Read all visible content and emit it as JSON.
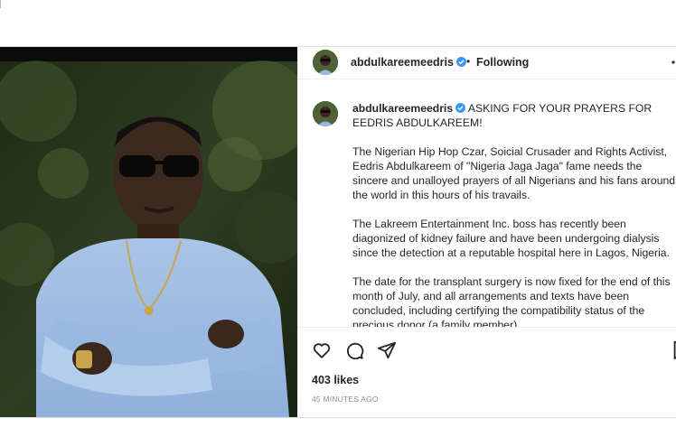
{
  "post": {
    "author": {
      "username": "abdulkareemeedris",
      "verified": true,
      "follow_state": "Following",
      "separator": "•"
    },
    "caption": {
      "username": "abdulkareemeedris",
      "headline": "ASKING FOR YOUR PRAYERS FOR EEDRIS ABDULKAREEM!",
      "paragraphs": [
        "The Nigerian Hip Hop Czar, Soicial Crusader and Rights Activist, Eedris Abdulkareem of \"Nigeria Jaga Jaga\" fame needs the sincere and unalloyed prayers of all Nigerians and his fans around the world in this hours of his travails.",
        "The Lakreem Entertainment Inc. boss has recently been diagonized of kidney failure and have been undergoing dialysis since the detection at a reputable hospital here in Lagos, Nigeria.",
        "The date for the transplant surgery is now fixed for the end of this month of July, and all arrangements and texts have been concluded, including certifying the compatibility status of the precious donor (a family member)."
      ]
    },
    "likes_text": "403 likes",
    "time_text": "45 MINUTES AGO",
    "icons": {
      "like": "heart-icon",
      "comment": "comment-icon",
      "share": "share-icon",
      "save": "bookmark-icon",
      "more": "more-icon",
      "verified": "verified-badge-icon"
    },
    "colors": {
      "verified_blue": "#3897f0",
      "text": "#262626",
      "muted": "#8e8e8e",
      "divider": "#dbdbdb"
    }
  }
}
